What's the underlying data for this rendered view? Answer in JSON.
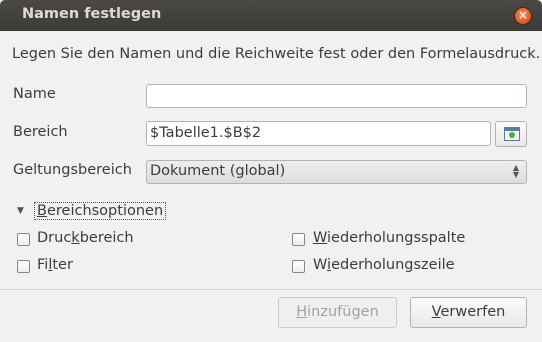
{
  "window": {
    "title": "Namen festlegen",
    "close_glyph": "×"
  },
  "description": "Legen Sie den Namen und die Reichweite fest oder den Formelausdruck.",
  "fields": {
    "name_label": "Name",
    "name_value": "",
    "range_label": "Bereich",
    "range_value": "$Tabelle1.$B$2",
    "scope_label": "Geltungsbereich",
    "scope_value": "Dokument (global)"
  },
  "options": {
    "expander_glyph": "▼",
    "expander_label": "Bereichsoptionen",
    "print_range": {
      "pre": "Druc",
      "key": "k",
      "post": "bereich",
      "checked": false
    },
    "filter": {
      "pre": "Fi",
      "key": "l",
      "post": "ter",
      "checked": false
    },
    "repeat_column": {
      "pre": "",
      "key": "W",
      "post": "iederholungsspalte",
      "checked": false
    },
    "repeat_row": {
      "pre": "W",
      "key": "i",
      "post": "ederholungszeile",
      "checked": false
    }
  },
  "buttons": {
    "add": {
      "pre": "",
      "key": "H",
      "post": "inzufügen",
      "enabled": false
    },
    "discard": {
      "pre": "",
      "key": "V",
      "post": "erwerfen",
      "enabled": true
    }
  },
  "icons": {
    "shrink": "shrink-dialog-icon",
    "combo_arrows": "updown-arrows-icon"
  },
  "colors": {
    "titlebar": "#3c3b37",
    "close": "#e0561e",
    "background": "#f2f1f0"
  }
}
